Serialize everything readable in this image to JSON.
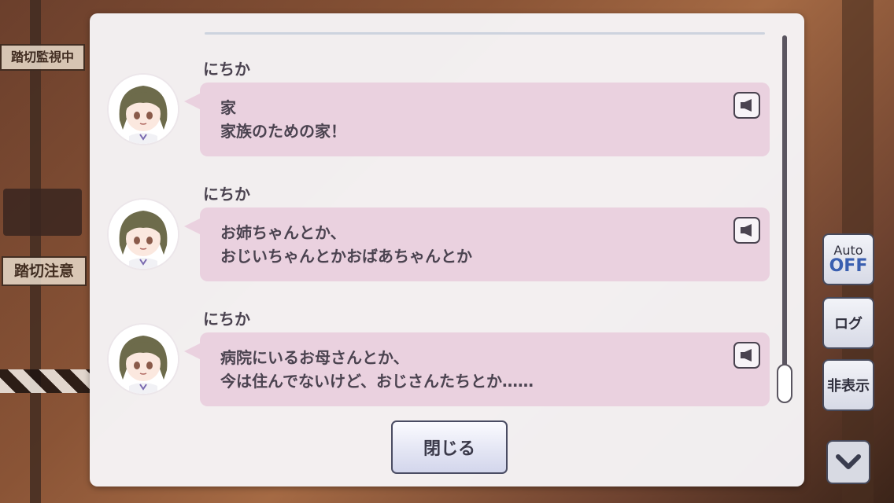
{
  "background": {
    "sign_top": "踏切監視中",
    "sign_mid": "踏切注意"
  },
  "log": {
    "entries": [
      {
        "speaker": "にちか",
        "line1": "家",
        "line2": "家族のための家！"
      },
      {
        "speaker": "にちか",
        "line1": "お姉ちゃんとか、",
        "line2": "おじいちゃんとかおばあちゃんとか"
      },
      {
        "speaker": "にちか",
        "line1": "病院にいるお母さんとか、",
        "line2": "今は住んでないけど、おじさんたちとか……"
      }
    ],
    "voice_icon": "speaker-icon",
    "close_label": "閉じる"
  },
  "controls": {
    "auto_label": "Auto",
    "auto_state": "OFF",
    "log_label": "ログ",
    "hide_label": "非表示",
    "down_icon": "chevron-down-icon"
  },
  "colors": {
    "bubble": "#ead1df",
    "text": "#4b4350",
    "auto_off": "#3a5fb0"
  }
}
